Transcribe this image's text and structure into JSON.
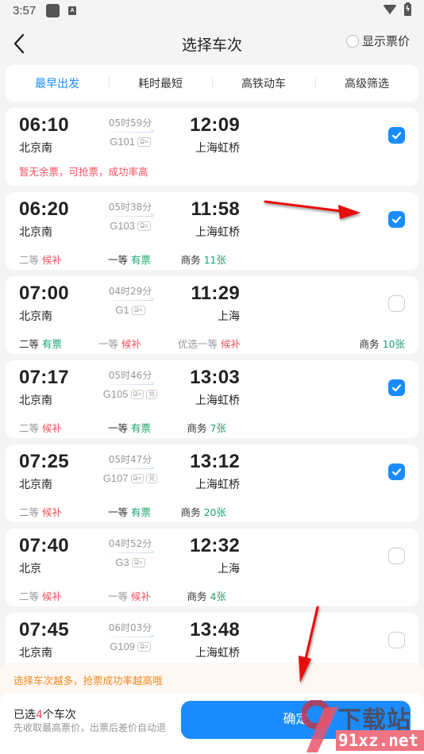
{
  "status_bar": {
    "time": "3:57",
    "icons": [
      "notification-square-icon",
      "a-input-icon",
      "wifi-icon",
      "battery-charging-icon"
    ]
  },
  "header": {
    "title": "选择车次",
    "back_icon": "chevron-left-icon",
    "show_price": {
      "label": "显示票价",
      "checked": false
    }
  },
  "tabs": [
    {
      "label": "最早出发",
      "active": true
    },
    {
      "label": "耗时最短",
      "active": false
    },
    {
      "label": "高铁动车",
      "active": false
    },
    {
      "label": "高级筛选",
      "active": false
    }
  ],
  "colors": {
    "accent": "#1a8cff",
    "red": "#f5505e",
    "green": "#16a46b",
    "tip_orange": "#f08a24",
    "background": "#f4f4f4"
  },
  "trains": [
    {
      "depart_time": "06:10",
      "depart_station": "北京南",
      "duration": "05时59分",
      "train_no": "G101",
      "tags": [
        "ID"
      ],
      "arrive_time": "12:09",
      "arrive_station": "上海虹桥",
      "selected": true,
      "warning": "暂无余票，可抢票，成功率高",
      "seats": []
    },
    {
      "depart_time": "06:20",
      "depart_station": "北京南",
      "duration": "05时38分",
      "train_no": "G103",
      "tags": [
        "ID"
      ],
      "arrive_time": "11:58",
      "arrive_station": "上海虹桥",
      "selected": true,
      "seats": [
        {
          "class": "二等",
          "status": "候补",
          "status_color": "red",
          "class_dim": true
        },
        {
          "class": "一等",
          "status": "有票",
          "status_color": "green",
          "class_dim": false
        },
        {
          "class": "商务",
          "status": "11张",
          "status_color": "green",
          "class_dim": false
        }
      ]
    },
    {
      "depart_time": "07:00",
      "depart_station": "北京南",
      "duration": "04时29分",
      "train_no": "G1",
      "tags": [
        "ID"
      ],
      "arrive_time": "11:29",
      "arrive_station": "上海",
      "selected": false,
      "seats": [
        {
          "class": "二等",
          "status": "有票",
          "status_color": "green",
          "class_dim": false
        },
        {
          "class": "一等",
          "status": "候补",
          "status_color": "red",
          "class_dim": true
        },
        {
          "class": "优选一等",
          "status": "候补",
          "status_color": "red",
          "class_dim": true
        },
        {
          "class": "商务",
          "status": "10张",
          "status_color": "green",
          "class_dim": false
        }
      ]
    },
    {
      "depart_time": "07:17",
      "depart_station": "北京南",
      "duration": "05时46分",
      "train_no": "G105",
      "tags": [
        "ID",
        "兑"
      ],
      "arrive_time": "13:03",
      "arrive_station": "上海虹桥",
      "selected": true,
      "seats": [
        {
          "class": "二等",
          "status": "候补",
          "status_color": "red",
          "class_dim": true
        },
        {
          "class": "一等",
          "status": "有票",
          "status_color": "green",
          "class_dim": false
        },
        {
          "class": "商务",
          "status": "7张",
          "status_color": "green",
          "class_dim": false
        }
      ]
    },
    {
      "depart_time": "07:25",
      "depart_station": "北京南",
      "duration": "05时47分",
      "train_no": "G107",
      "tags": [
        "ID",
        "兑"
      ],
      "arrive_time": "13:12",
      "arrive_station": "上海虹桥",
      "selected": true,
      "seats": [
        {
          "class": "二等",
          "status": "候补",
          "status_color": "red",
          "class_dim": true
        },
        {
          "class": "一等",
          "status": "有票",
          "status_color": "green",
          "class_dim": false
        },
        {
          "class": "商务",
          "status": "20张",
          "status_color": "green",
          "class_dim": false
        }
      ]
    },
    {
      "depart_time": "07:40",
      "depart_station": "北京",
      "duration": "04时52分",
      "train_no": "G3",
      "tags": [
        "ID"
      ],
      "arrive_time": "12:32",
      "arrive_station": "上海",
      "selected": false,
      "seats": [
        {
          "class": "二等",
          "status": "候补",
          "status_color": "red",
          "class_dim": true
        },
        {
          "class": "一等",
          "status": "候补",
          "status_color": "red",
          "class_dim": true
        },
        {
          "class": "商务",
          "status": "4张",
          "status_color": "green",
          "class_dim": false
        }
      ]
    },
    {
      "depart_time": "07:45",
      "depart_station": "北京南",
      "duration": "06时03分",
      "train_no": "G109",
      "tags": [
        "ID"
      ],
      "arrive_time": "13:48",
      "arrive_station": "上海虹桥",
      "selected": false,
      "seats": []
    }
  ],
  "tip": "选择车次越多，抢票成功率越高哦",
  "footer": {
    "selected_prefix": "已选",
    "selected_count": "4",
    "selected_suffix": "个车次",
    "note": "先收取最高票价，出票后差价自动退",
    "confirm_label": "确定"
  },
  "watermark": {
    "brand": "下载站",
    "url": "91xz.net"
  }
}
